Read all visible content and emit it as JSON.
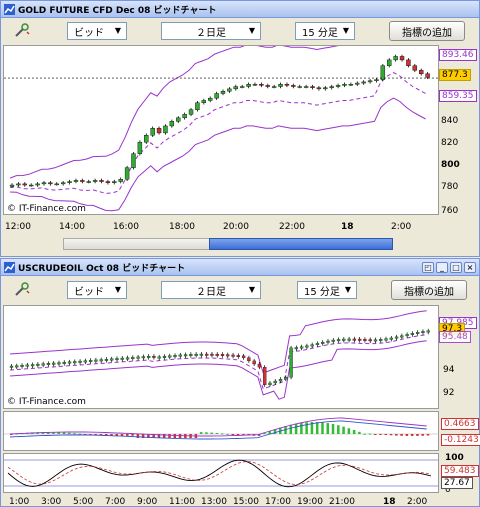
{
  "window1": {
    "title": "GOLD FUTURE CFD Dec 08 ビッドチャート",
    "toolbar": {
      "price_type": "ビッド",
      "period": "２日足",
      "interval": "15 分足",
      "add_indicator": "指標の追加"
    },
    "price_labels": [
      "893.46",
      "877.3",
      "859.35"
    ],
    "y_ticks": [
      "840",
      "820",
      "800",
      "780",
      "760"
    ],
    "x_ticks": [
      "12:00",
      "14:00",
      "16:00",
      "18:00",
      "20:00",
      "22:00",
      "18",
      "2:00"
    ],
    "watermark": "© IT-Finance.com",
    "chart_data": {
      "type": "candlestick",
      "ylim": [
        760,
        905
      ],
      "close": [
        785,
        786,
        785,
        785,
        786,
        787,
        786,
        786,
        787,
        788,
        789,
        788,
        788,
        789,
        788,
        787,
        788,
        790,
        800,
        812,
        822,
        828,
        834,
        830,
        836,
        840,
        843,
        846,
        850,
        856,
        858,
        860,
        864,
        866,
        868,
        870,
        870,
        872,
        872,
        871,
        870,
        870,
        872,
        871,
        870,
        870,
        870,
        869,
        868,
        869,
        870,
        871,
        872,
        872,
        873,
        874,
        875,
        876,
        888,
        893,
        896,
        893,
        888,
        884,
        881,
        878
      ],
      "open": [
        784,
        785,
        786,
        785,
        785,
        786,
        787,
        786,
        786,
        787,
        788,
        789,
        788,
        788,
        789,
        788,
        787,
        788,
        790,
        800,
        812,
        822,
        828,
        834,
        830,
        836,
        840,
        843,
        846,
        850,
        856,
        858,
        860,
        864,
        866,
        868,
        870,
        870,
        872,
        872,
        871,
        870,
        870,
        872,
        871,
        870,
        870,
        870,
        869,
        868,
        869,
        870,
        871,
        872,
        872,
        873,
        874,
        875,
        876,
        888,
        893,
        896,
        893,
        888,
        884,
        881
      ],
      "bb_upper": 893.46,
      "bb_lower": 859.35,
      "last": 877.3
    }
  },
  "window2": {
    "title": "USCRUDEOIL Oct 08 ビッドチャート",
    "toolbar": {
      "price_type": "ビッド",
      "period": "２日足",
      "interval": "15 分足",
      "add_indicator": "指標の追加"
    },
    "price_labels": [
      "97.985",
      "97.3",
      "95.48"
    ],
    "y_ticks": [
      "94",
      "92"
    ],
    "macd_labels": [
      "0.4663",
      "-0.1243"
    ],
    "stoch_labels": [
      "100",
      "59.483",
      "27.67",
      "0"
    ],
    "x_ticks": [
      "1:00",
      "3:00",
      "5:00",
      "7:00",
      "9:00",
      "11:00",
      "13:00",
      "15:00",
      "17:00",
      "19:00",
      "21:00",
      "18",
      "2:00"
    ],
    "watermark": "© IT-Finance.com"
  },
  "colors": {
    "band": "#9933cc",
    "mid": "#9933cc",
    "up": "#33aa33",
    "down": "#cc3333",
    "last_box": "#ffcc00",
    "macd_up": "#33bb33",
    "macd_dn": "#cc3333"
  }
}
